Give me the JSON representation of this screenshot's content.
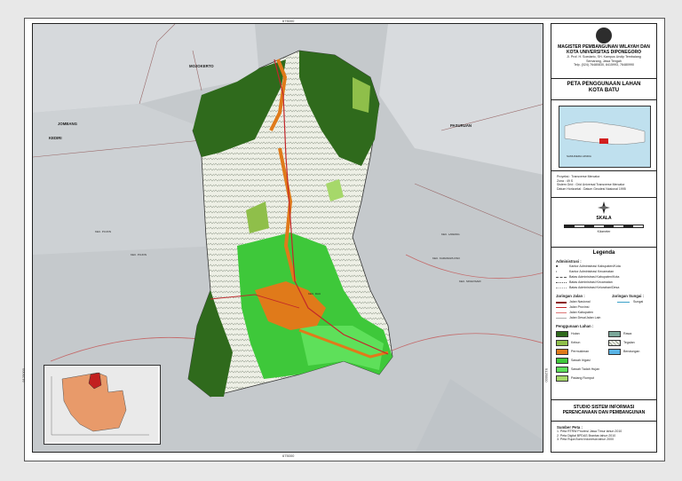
{
  "map": {
    "coord_top": "675000",
    "coord_bottom": "675000",
    "coord_left": "9125000",
    "coord_right": "9125000",
    "places": {
      "mojokerto": "MOJOKERTO",
      "jombang": "JOMBANG",
      "kediri": "KEDIRI",
      "pasuruan": "PASURUAN"
    },
    "district_labels": [
      "KEC. PUJON",
      "KEC. PUJON",
      "KEC. DAU",
      "KEC. KARANGPLOSO",
      "KEC. LAWANG",
      "KEC. SINGOSARI"
    ]
  },
  "panel": {
    "institution": "MAGISTER PEMBANGUNAN WILAYAH DAN KOTA UNIVERSITAS DIPONEGORO",
    "address_1": "Jl. Prof. H. Soedarto, SH. Kampus Undip Tembalang",
    "address_2": "Semarang, Jawa Tengah",
    "address_3": "Telp. (024) 76480830, 8415993, 76480990",
    "map_title": "PETA PENGGUNAAN LAHAN",
    "map_subtitle": "KOTA BATU",
    "meta": [
      {
        "k": "Proyeksi",
        "v": "Transverse Mercator"
      },
      {
        "k": "Zona",
        "v": "49 S"
      },
      {
        "k": "Sistem Grid",
        "v": "Grid Universal Transverse Mercator"
      },
      {
        "k": "Datum Horizontal",
        "v": "Datum Geodesi Nasional 1995"
      }
    ],
    "scale_label": "SKALA",
    "scale_unit": "Kilometer",
    "inset_sea_label": "SAMUDERA HINDIA",
    "legend_title": "Legenda",
    "admin_head": "Administrasi :",
    "admin_items": [
      "Kantor Administrasi Kabupaten/Kota",
      "Kantor Administrasi Kecamatan",
      "Batas Administrasi Kabupaten/Kota",
      "Batas Administrasi Kecamatan",
      "Batas Administrasi Kelurahan/Desa"
    ],
    "road_head": "Jaringan Jalan :",
    "river_head": "Jaringan Sungai :",
    "river_item": "Sungai",
    "road_items": [
      "Jalan Nasional",
      "Jalan Provinsi",
      "Jalan Kabupaten",
      "Jalan Desa/Jalan Lain"
    ],
    "landuse_head": "Penggunaan Lahan :",
    "landuse_left": [
      "Hutan",
      "Kebun",
      "Permukiman",
      "Sawah Irigasi",
      "Sawah Tadah Hujan",
      "Padang Rumput"
    ],
    "landuse_right": [
      "Rawa",
      "Tegalan",
      "Bendungan"
    ],
    "studio_1": "STUDIO SISTEM INFORMASI",
    "studio_2": "PERENCANAAN DAN PEMBANGUNAN",
    "sources_head": "Sumber Peta :",
    "sources": [
      "1. Peta RTRW Provinsi Jawa Timur tahun 2010",
      "2. Peta Digital BPDAS Brantas tahun 2010",
      "3. Peta Rupa Bumi Indonesia tahun 2000"
    ]
  },
  "colors": {
    "forest": "#2f6a1c",
    "plantation": "#8fbf4a",
    "settlement": "#e07a1a",
    "irrigated": "#3ec83a",
    "rainfed": "#5ee05a",
    "grass": "#a6d86a",
    "swamp": "#7aa79a",
    "dryfield": "#eef0e6",
    "reservoir": "#5ab4e6",
    "outside": "#c9cdd0",
    "water": "#b9dbe9"
  }
}
